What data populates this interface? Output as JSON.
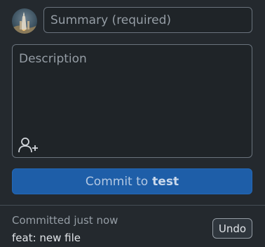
{
  "summary": {
    "placeholder": "Summary (required)",
    "value": ""
  },
  "description": {
    "placeholder": "Description",
    "value": ""
  },
  "coauthor": {
    "icon": "person-add-icon"
  },
  "commit_button": {
    "prefix": "Commit to",
    "branch": "test"
  },
  "last_commit": {
    "status": "Committed just now",
    "message": "feat: new file",
    "undo_label": "Undo"
  },
  "colors": {
    "background": "#24292e",
    "input_background": "#1f2428",
    "border": "#6a737d",
    "commit_button": "#1e5ea8"
  }
}
